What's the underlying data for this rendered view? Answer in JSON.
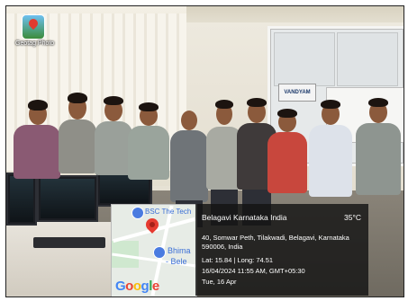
{
  "geotag": {
    "label": "Geotag Photo",
    "icon": "geotag-photo-icon"
  },
  "scene": {
    "sign_text": "VANDYAM"
  },
  "map": {
    "label_top": "BSC The Tech",
    "label_place": "Bhima",
    "label_place_2": "- Bele",
    "provider": [
      "G",
      "o",
      "o",
      "g",
      "l",
      "e"
    ]
  },
  "location": {
    "city": "Belagavi Karnataka India",
    "temperature": "35°C",
    "address": "40, Somwar Peth, Tilakwadi, Belagavi, Karnataka 590006, India",
    "lat_long": "Lat: 15.84 | Long: 74.51",
    "datetime": "16/04/2024 11:55 AM, GMT+05:30",
    "day": "Tue, 16 Apr"
  },
  "colors": {
    "panel_bg": "#141414",
    "pin": "#e53a2f"
  }
}
